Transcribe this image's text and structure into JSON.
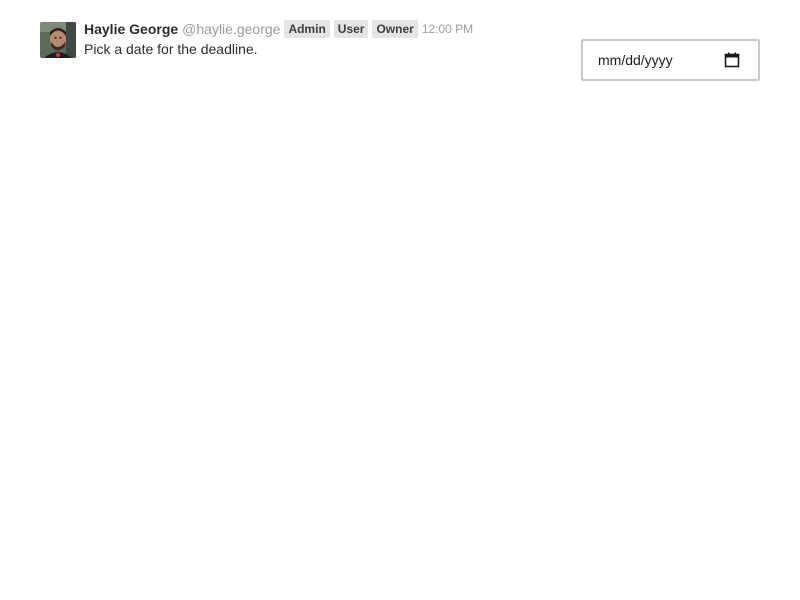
{
  "message": {
    "author": {
      "name": "Haylie George",
      "handle": "@haylie.george"
    },
    "badges": [
      "Admin",
      "User",
      "Owner"
    ],
    "timestamp": "12:00 PM",
    "text": "Pick a date for the deadline."
  },
  "date_picker": {
    "placeholder": "mm/dd/yyyy",
    "icon": "calendar-icon"
  },
  "colors": {
    "name_text": "#2c2d30",
    "muted_text": "#9a9b9d",
    "badge_bg": "#e3e4e6",
    "input_border": "#c9c9cb"
  }
}
